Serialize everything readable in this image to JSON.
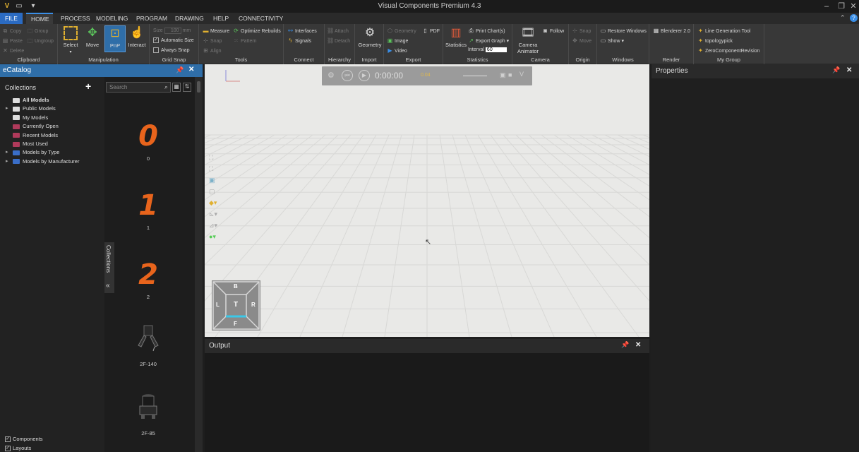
{
  "window": {
    "title": "Visual Components Premium 4.3"
  },
  "menu_tabs": [
    "FILE",
    "HOME",
    "PROCESS",
    "MODELING",
    "PROGRAM",
    "DRAWING",
    "HELP",
    "CONNECTIVITY"
  ],
  "ribbon": {
    "clipboard": {
      "label": "Clipboard",
      "copy": "Copy",
      "paste": "Paste",
      "delete": "Delete",
      "group": "Group",
      "ungroup": "Ungroup"
    },
    "manipulation": {
      "label": "Manipulation",
      "select": "Select",
      "move": "Move",
      "pnp": "PnP",
      "interact": "Interact"
    },
    "grid_snap": {
      "label": "Grid Snap",
      "size_label": "Size",
      "size_value": "100",
      "size_unit": "mm",
      "automatic_size": "Automatic Size",
      "always_snap": "Always Snap"
    },
    "tools": {
      "label": "Tools",
      "measure": "Measure",
      "snap": "Snap",
      "align": "Align",
      "optimize_rebuilds": "Optimize Rebuilds",
      "pattern": "Pattern"
    },
    "connect": {
      "label": "Connect",
      "interfaces": "Interfaces",
      "signals": "Signals"
    },
    "hierarchy": {
      "label": "Hierarchy",
      "attach": "Attach",
      "detach": "Detach"
    },
    "import": {
      "label": "Import",
      "geometry": "Geometry"
    },
    "export": {
      "label": "Export",
      "geometry": "Geometry",
      "pdf": "PDF",
      "image": "Image",
      "video": "Video"
    },
    "statistics": {
      "label": "Statistics",
      "statistics": "Statistics",
      "print_charts": "Print Chart(s)",
      "export_graph": "Export Graph",
      "interval_label": "Interval",
      "interval_value": "60"
    },
    "camera": {
      "label": "Camera",
      "camera_animator": "Camera Animator",
      "follow": "Follow"
    },
    "origin": {
      "label": "Origin",
      "snap": "Snap",
      "move": "Move"
    },
    "windows": {
      "label": "Windows",
      "restore_windows": "Restore Windows",
      "show": "Show"
    },
    "render": {
      "label": "Render",
      "blenderer": "Blenderer 2.0"
    },
    "my_group": {
      "label": "My Group",
      "line_generation_tool": "Line Generation Tool",
      "topologypick": "topologypick",
      "zero_component_revision": "ZeroComponentRevision"
    }
  },
  "ecatalog": {
    "title": "eCatalog",
    "collections_label": "Collections",
    "search_placeholder": "Search",
    "side_tab": "Collections",
    "tree": [
      {
        "label": "All Models",
        "color": "#dddddd",
        "expandable": false,
        "bold": true
      },
      {
        "label": "Public Models",
        "color": "#dddddd",
        "expandable": true,
        "bold": false
      },
      {
        "label": "My Models",
        "color": "#dddddd",
        "expandable": false,
        "bold": false
      },
      {
        "label": "Currently Open",
        "color": "#b03a5b",
        "expandable": false,
        "bold": false
      },
      {
        "label": "Recent Models",
        "color": "#b03a5b",
        "expandable": false,
        "bold": false
      },
      {
        "label": "Most Used",
        "color": "#b03a5b",
        "expandable": false,
        "bold": false
      },
      {
        "label": "Models by Type",
        "color": "#3a6ec8",
        "expandable": true,
        "bold": false
      },
      {
        "label": "Models by Manufacturer",
        "color": "#3a6ec8",
        "expandable": true,
        "bold": false
      }
    ],
    "models": [
      {
        "glyph": "0",
        "label": "0"
      },
      {
        "glyph": "1",
        "label": "1"
      },
      {
        "glyph": "2",
        "label": "2"
      },
      {
        "glyph": "",
        "label": "2F-140"
      },
      {
        "glyph": "",
        "label": "2F-85"
      }
    ],
    "footer": {
      "components": "Components",
      "layouts": "Layouts"
    }
  },
  "viewport": {
    "playbar": {
      "time": "0:00:00",
      "speed": "0.04"
    },
    "navcube": {
      "top": "B",
      "left": "L",
      "center": "T",
      "right": "R",
      "bottom": "F"
    }
  },
  "output": {
    "title": "Output"
  },
  "properties": {
    "title": "Properties"
  }
}
